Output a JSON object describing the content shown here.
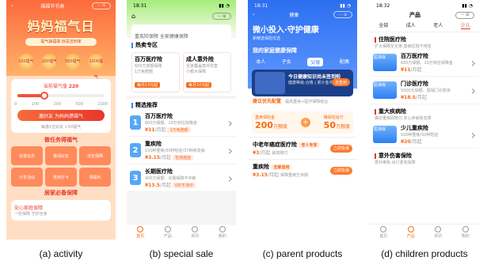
{
  "captions": [
    "(a) activity",
    "(b) special sale",
    "(c) parent products",
    "(d) children products"
  ],
  "activity": {
    "nav_title": "福福节节高",
    "capsule": "··· ⊙",
    "main_title": "妈妈福气日",
    "subtitle": "福气抽福袋 惊喜送到家",
    "coins": [
      "100福气",
      "200福气",
      "500福气",
      "1000福气"
    ],
    "ask_label": "当前福气值",
    "ask_value": "220",
    "slider_ticks": [
      "0",
      "100",
      "200",
      "500",
      "1000"
    ],
    "button": "邀好友 为妈妈攒福气",
    "hint": "每邀1位好友 +50福气",
    "task_title": "做任务得福气",
    "tasks": [
      "完善信息",
      "邀请好友",
      "浏览保障",
      "分享活动",
      "签到打卡",
      "领福利"
    ],
    "guard_title": "居家必备保障",
    "guard_text": "安心家庭保障",
    "guard_sub": "一份保障 守护全家"
  },
  "special": {
    "time": "18:31",
    "top_text": "重疾险保障 全家健康保障",
    "zone_title": "热卖专区",
    "zone_items": [
      {
        "name": "百万医疗险",
        "l1": "600万高额保障",
        "l2": "1万免赔额",
        "price": "每月13元起"
      },
      {
        "name": "成人意外险",
        "l1": "全家覆盖意外伤害",
        "l2": "小额大保障",
        "price": "每月10元起"
      }
    ],
    "picks_title": "精选推荐",
    "picks": [
      {
        "num": "1",
        "name": "百万医疗险",
        "desc": "600万保额、10万到住院降金",
        "price": "¥11",
        "unit": "/月起",
        "tag": "1万免赔额"
      },
      {
        "num": "2",
        "name": "重疾险",
        "desc": "100种重疾/50种轻症/37种疾发病",
        "price": "¥3.15",
        "unit": "/月起",
        "tag": "包括癌症"
      },
      {
        "num": "3",
        "name": "长期医疗险",
        "desc": "400万保额、长期保障不中断",
        "price": "¥13.5",
        "unit": "/月起",
        "tag": "6年不涨价"
      }
    ],
    "tabs": [
      "首页",
      "产品",
      "资讯",
      "我的"
    ]
  },
  "parent": {
    "time": "18:31",
    "nav_title": "健康",
    "headline": "微小投入·守护健康",
    "sub": "新精选保险优选",
    "section": "我的家庭健康保障",
    "tabs": [
      "本人",
      "子女",
      "父母",
      "配偶"
    ],
    "active_tab": "父母",
    "banner_line1": "今日健康知识尚未签到啦",
    "banner_line2": "健康等级:合格 | 累计金币:30",
    "banner_btn": "去签到",
    "combo_title": "建议优先配置",
    "combo_sub": "提高重疾+医疗保障组合",
    "combo_a_name": "重疾保险金",
    "combo_a_amt": "200",
    "combo_a_unit": "万额度",
    "combo_b_name": "赚保险给付",
    "combo_b_amt": "50",
    "combo_b_unit": "万额度",
    "products": [
      {
        "name": "中老年癌症医疗险",
        "tag": "老人专享",
        "price": "¥3",
        "unit": "/月起",
        "desc": "最高赔付",
        "btn": "立即投保"
      },
      {
        "name": "重疾险",
        "tag": "全家适用",
        "price": "¥3.15",
        "unit": "/月起",
        "desc": "保障重疾生存期",
        "btn": "立即投保"
      }
    ]
  },
  "children": {
    "time": "18:32",
    "nav_title": "产品",
    "tabs": [
      "全部",
      "成人",
      "老人",
      "少儿"
    ],
    "active_tab": "少儿",
    "sec1_title": "住院医疗险",
    "sec1_sub": "扩大保障至全家,患病住院不用愁",
    "items1": [
      {
        "img": "医保保",
        "name": "百万医疗险",
        "desc": "600万保额、10万到住保障金",
        "price": "¥11",
        "unit": "/月起"
      },
      {
        "img": "医保保",
        "name": "门诊医疗险",
        "desc": "5000元保额、报销门诊费用",
        "price": "¥18.5",
        "unit": "/月起"
      }
    ],
    "sec2_title": "重大疾病险",
    "sec2_sub": "确诊重疾即赔付,安心养病有支撑",
    "items2": [
      {
        "img": "医保保",
        "name": "少儿重疾险",
        "desc": "100种重疾/50种轻症",
        "price": "¥20",
        "unit": "/月起"
      }
    ],
    "sec3_title": "意外伤害保险",
    "sec3_sub": "意外难免,出行更有保障",
    "tabbar": [
      "首页",
      "产品",
      "资讯",
      "我的"
    ]
  }
}
